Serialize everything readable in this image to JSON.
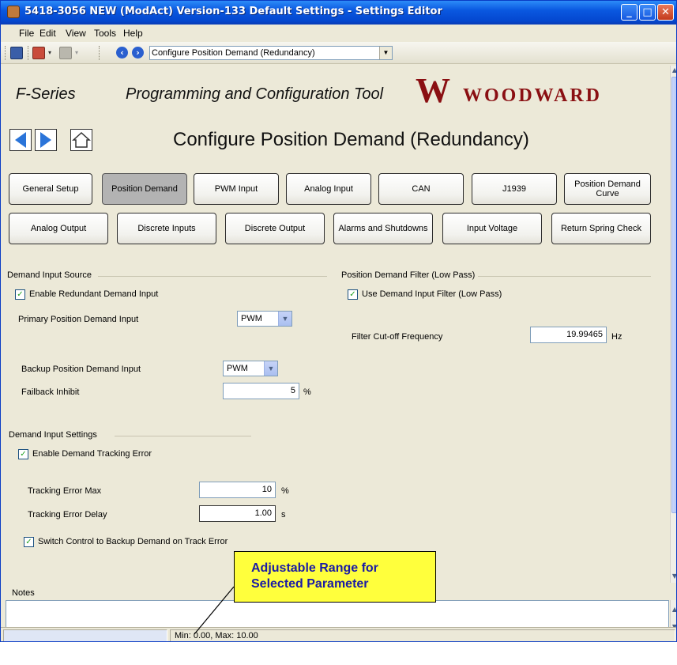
{
  "window": {
    "title": "5418-3056 NEW (ModAct) Version-133 Default Settings - Settings Editor"
  },
  "menu": [
    "File",
    "Edit",
    "View",
    "Tools",
    "Help"
  ],
  "toolbar": {
    "page_select": "Configure Position Demand (Redundancy)"
  },
  "header": {
    "series": "F-Series",
    "tool_name": "Programming and Configuration Tool",
    "logo": "WOODWARD"
  },
  "page_title": "Configure  Position Demand (Redundancy)",
  "tabs_row1": [
    "General Setup",
    "Position Demand",
    "PWM Input",
    "Analog Input",
    "CAN",
    "J1939",
    "Position Demand Curve"
  ],
  "tabs_row2": [
    "Analog Output",
    "Discrete Inputs",
    "Discrete Output",
    "Alarms and Shutdowns",
    "Input Voltage",
    "Return Spring Check"
  ],
  "active_tab": "Position Demand",
  "demand_source": {
    "group_title": "Demand Input Source",
    "enable_redundant_label": "Enable Redundant Demand Input",
    "enable_redundant_checked": true,
    "primary_label": "Primary Position Demand Input",
    "primary_value": "PWM",
    "backup_label": "Backup Position Demand Input",
    "backup_value": "PWM",
    "failback_label": "Failback Inhibit",
    "failback_value": "5",
    "failback_unit": "%"
  },
  "filter": {
    "group_title": "Position Demand Filter (Low Pass)",
    "use_filter_label": "Use Demand Input Filter (Low Pass)",
    "use_filter_checked": true,
    "cutoff_label": "Filter Cut-off Frequency",
    "cutoff_value": "19.99465",
    "cutoff_unit": "Hz"
  },
  "demand_settings": {
    "group_title": "Demand Input Settings",
    "tracking_error_label": "Enable Demand Tracking Error",
    "tracking_error_checked": true,
    "max_label": "Tracking Error Max",
    "max_value": "10",
    "max_unit": "%",
    "delay_label": "Tracking Error Delay",
    "delay_value": "1.00",
    "delay_unit": "s",
    "switch_label": "Switch Control to Backup Demand on Track Error",
    "switch_checked": true
  },
  "notes": {
    "label": "Notes",
    "value": ""
  },
  "status": {
    "range": "Min: 0.00, Max: 10.00"
  },
  "callout": {
    "line1": "Adjustable Range for",
    "line2": "Selected Parameter"
  },
  "colors": {
    "logo": "#8a0f12",
    "callout_fill": "#ffff3c",
    "callout_text": "#1a1aa6",
    "check": "#21a121"
  }
}
